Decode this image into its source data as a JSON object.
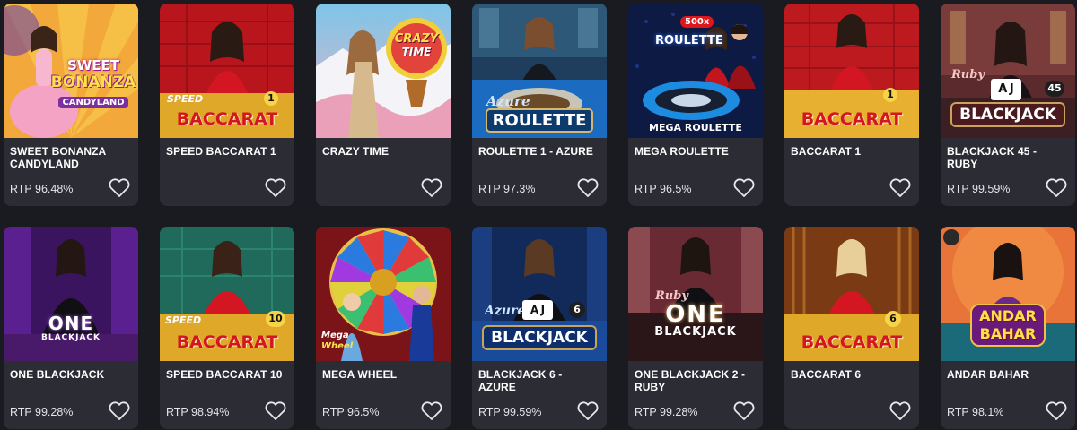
{
  "games": [
    {
      "title": "SWEET BONANZA CANDYLAND",
      "rtp": "RTP 96.48%",
      "logo": [
        "SWEET",
        "BONANZA",
        "CANDYLAND"
      ]
    },
    {
      "title": "SPEED BACCARAT 1",
      "rtp": "",
      "logo": [
        "SPEED",
        "BACCARAT",
        "1"
      ]
    },
    {
      "title": "CRAZY TIME",
      "rtp": "",
      "logo": [
        "CRAZY",
        "TIME"
      ]
    },
    {
      "title": "ROULETTE 1 - AZURE",
      "rtp": "RTP 97.3%",
      "logo": [
        "Azure",
        "ROULETTE"
      ]
    },
    {
      "title": "MEGA ROULETTE",
      "rtp": "RTP 96.5%",
      "logo": [
        "500x",
        "ROULETTE",
        "MEGA ROULETTE"
      ]
    },
    {
      "title": "BACCARAT 1",
      "rtp": "",
      "logo": [
        "BACCARAT",
        "1"
      ]
    },
    {
      "title": "BLACKJACK 45 - RUBY",
      "rtp": "RTP 99.59%",
      "logo": [
        "Ruby",
        "BLACKJACK",
        "45"
      ]
    },
    {
      "title": "ONE BLACKJACK",
      "rtp": "RTP 99.28%",
      "logo": [
        "ONE",
        "BLACKJACK"
      ]
    },
    {
      "title": "SPEED BACCARAT 10",
      "rtp": "RTP 98.94%",
      "logo": [
        "SPEED",
        "BACCARAT",
        "10"
      ]
    },
    {
      "title": "MEGA WHEEL",
      "rtp": "RTP 96.5%",
      "logo": [
        "Mega",
        "Wheel"
      ]
    },
    {
      "title": "BLACKJACK 6 - AZURE",
      "rtp": "RTP 99.59%",
      "logo": [
        "Azure",
        "BLACKJACK",
        "6"
      ]
    },
    {
      "title": "ONE BLACKJACK 2 - RUBY",
      "rtp": "RTP 99.28%",
      "logo": [
        "Ruby",
        "ONE",
        "BLACKJACK"
      ]
    },
    {
      "title": "BACCARAT 6",
      "rtp": "",
      "logo": [
        "BACCARAT",
        "6"
      ]
    },
    {
      "title": "ANDAR BAHAR",
      "rtp": "RTP 98.1%",
      "logo": [
        "ANDAR",
        "BAHAR"
      ]
    }
  ],
  "icons": {
    "favorite": "heart-outline-icon"
  },
  "colors": {
    "background": "#1a1b21",
    "card": "#2b2c34",
    "text": "#ffffff",
    "rtp": "#e4e4ea"
  }
}
